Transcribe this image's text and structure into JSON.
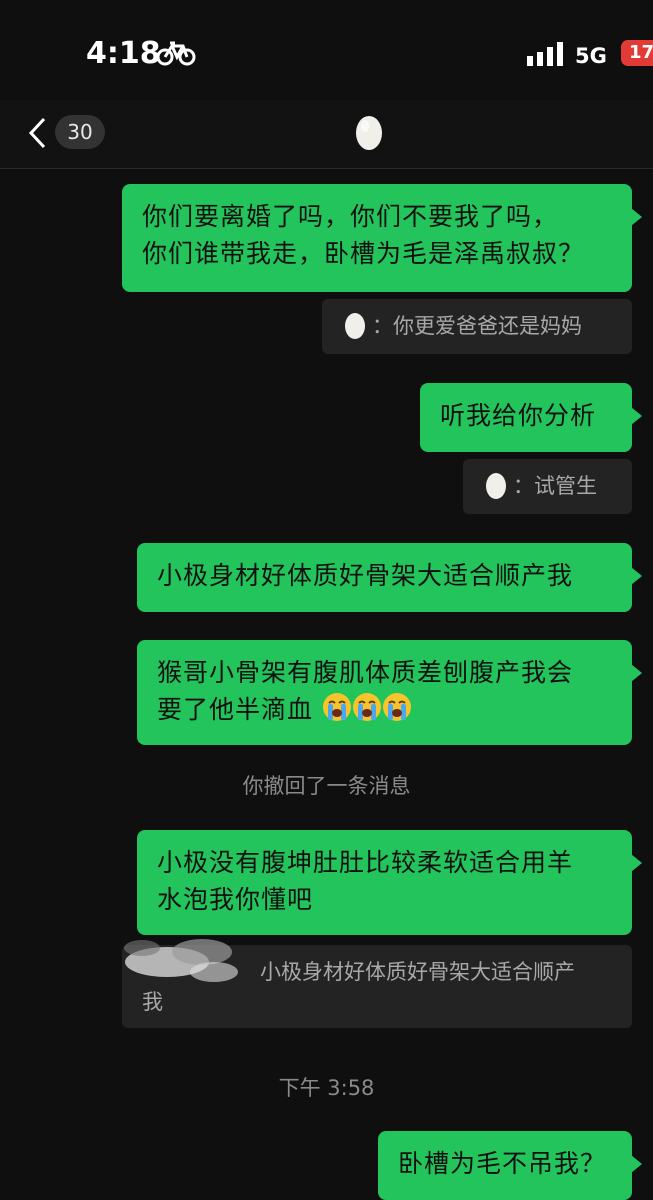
{
  "status_bar": {
    "time": "4:18",
    "network": "5G",
    "battery": "17"
  },
  "nav": {
    "unread_count": "30",
    "contact_avatar": "egg-icon"
  },
  "messages": [
    {
      "line1": "你们要离婚了吗，你们不要我了吗，",
      "line2": "你们谁带我走，卧槽为毛是泽禹叔叔？"
    },
    {
      "quote_text": "你更爱爸爸还是妈妈",
      "quote_prefix": "："
    },
    {
      "text": "听我给你分析"
    },
    {
      "quote_text": "试管生",
      "quote_prefix": "："
    },
    {
      "text": "小极身材好体质好骨架大适合顺产我"
    },
    {
      "line1": "猴哥小骨架有腹肌体质差刨腹产我会",
      "line2": "要了他半滴血"
    },
    {
      "system": "你撤回了一条消息"
    },
    {
      "line1": "小极没有腹坤肚肚比较柔软适合用羊",
      "line2": "水泡我你懂吧"
    },
    {
      "quote_line1": "小极身材好体质好骨架大适合顺产",
      "quote_line2": "我"
    },
    {
      "timestamp": "下午 3:58"
    },
    {
      "text": "卧槽为毛不吊我？"
    }
  ],
  "colors": {
    "bubble": "#23c45c",
    "background": "#0f0f0f",
    "quote_bg": "#232323"
  },
  "icons": {
    "crying_emoji": "loudly-crying-face-icon",
    "egg": "egg-icon",
    "back": "chevron-left-icon",
    "bike": "bicycle-icon"
  }
}
